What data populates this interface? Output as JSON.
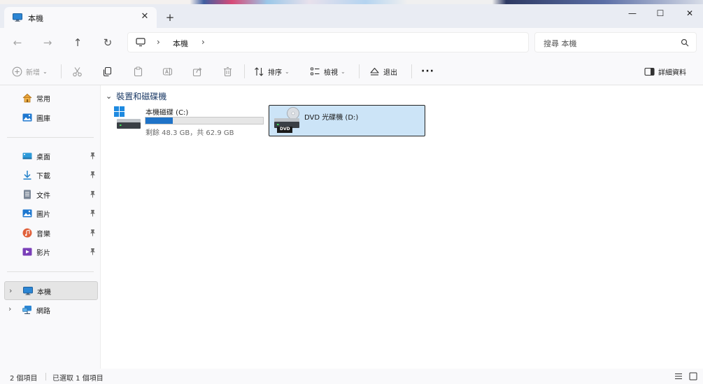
{
  "tab": {
    "title": "本機",
    "close": "✕",
    "new": "+"
  },
  "window": {
    "minimize": "—",
    "maximize": "☐",
    "close": "✕"
  },
  "nav": {
    "back": "←",
    "forward": "→",
    "up": "↑",
    "refresh": "↻"
  },
  "address": {
    "chevron": "›",
    "segment": "本機"
  },
  "search": {
    "placeholder": "搜尋 本機"
  },
  "toolbar": {
    "new_label": "新增",
    "sort_label": "排序",
    "view_label": "檢視",
    "eject_label": "退出",
    "more": "···",
    "details_label": "詳細資料",
    "dropdown": "⌄"
  },
  "sidebar": {
    "quick": [
      {
        "label": "常用"
      },
      {
        "label": "圖庫"
      }
    ],
    "pinned": [
      {
        "label": "桌面"
      },
      {
        "label": "下載"
      },
      {
        "label": "文件"
      },
      {
        "label": "圖片"
      },
      {
        "label": "音樂"
      },
      {
        "label": "影片"
      }
    ],
    "tree": [
      {
        "label": "本機"
      },
      {
        "label": "網路"
      }
    ],
    "chevron": "›"
  },
  "content": {
    "group_title": "裝置和磁碟機",
    "group_chevron": "⌄",
    "drives": [
      {
        "name": "本機磁碟 (C:)",
        "usage": "剩餘 48.3 GB，共 62.9 GB",
        "used_fraction": 0.232
      },
      {
        "name": "DVD 光碟機 (D:)",
        "badge": "DVD"
      }
    ]
  },
  "status": {
    "count": "2 個項目",
    "selected": "已選取 1 個項目"
  },
  "colors": {
    "accent": "#1f73c8",
    "selection": "#cce4f7"
  }
}
